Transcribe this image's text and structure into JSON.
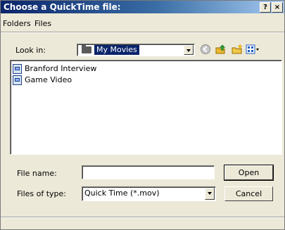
{
  "dialog": {
    "title": "Choose a QuickTime file:",
    "help_button": "?",
    "close_button": "×"
  },
  "menu": {
    "items": [
      "Folders",
      "Files"
    ]
  },
  "look_in": {
    "label": "Look in:",
    "selected": "My Movies"
  },
  "toolbar": {
    "icons": [
      "back-icon",
      "up-folder-icon",
      "new-folder-icon",
      "view-menu-icon"
    ]
  },
  "files": [
    {
      "name": "Branford Interview",
      "icon": "movie-file-icon"
    },
    {
      "name": "Game Video",
      "icon": "movie-file-icon"
    }
  ],
  "file_name": {
    "label": "File name:",
    "value": ""
  },
  "file_type": {
    "label": "Files of type:",
    "selected": "Quick Time (*.mov)"
  },
  "buttons": {
    "open": "Open",
    "cancel": "Cancel"
  }
}
